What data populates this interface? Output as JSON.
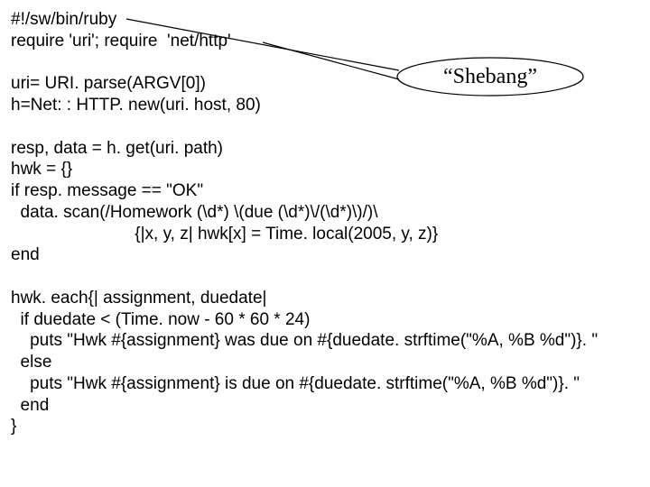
{
  "code": {
    "l1": "#!/sw/bin/ruby",
    "l2": "require 'uri'; require  'net/http'",
    "l3": "",
    "l4": "uri= URI. parse(ARGV[0])",
    "l5": "h=Net: : HTTP. new(uri. host, 80)",
    "l6": "",
    "l7": "resp, data = h. get(uri. path)",
    "l8": "hwk = {}",
    "l9": "if resp. message == \"OK\"",
    "l10": "  data. scan(/Homework (\\d*) \\(due (\\d*)\\/(\\d*)\\)/)\\",
    "l11": "                          {|x, y, z| hwk[x] = Time. local(2005, y, z)}",
    "l12": "end",
    "l13": "",
    "l14": "hwk. each{| assignment, duedate|",
    "l15": "  if duedate < (Time. now - 60 * 60 * 24)",
    "l16": "    puts \"Hwk #{assignment} was due on #{duedate. strftime(\"%A, %B %d\")}. \"",
    "l17": "  else",
    "l18": "    puts \"Hwk #{assignment} is due on #{duedate. strftime(\"%A, %B %d\")}. \"",
    "l19": "  end",
    "l20": "}"
  },
  "callout": {
    "label": "“Shebang”"
  }
}
